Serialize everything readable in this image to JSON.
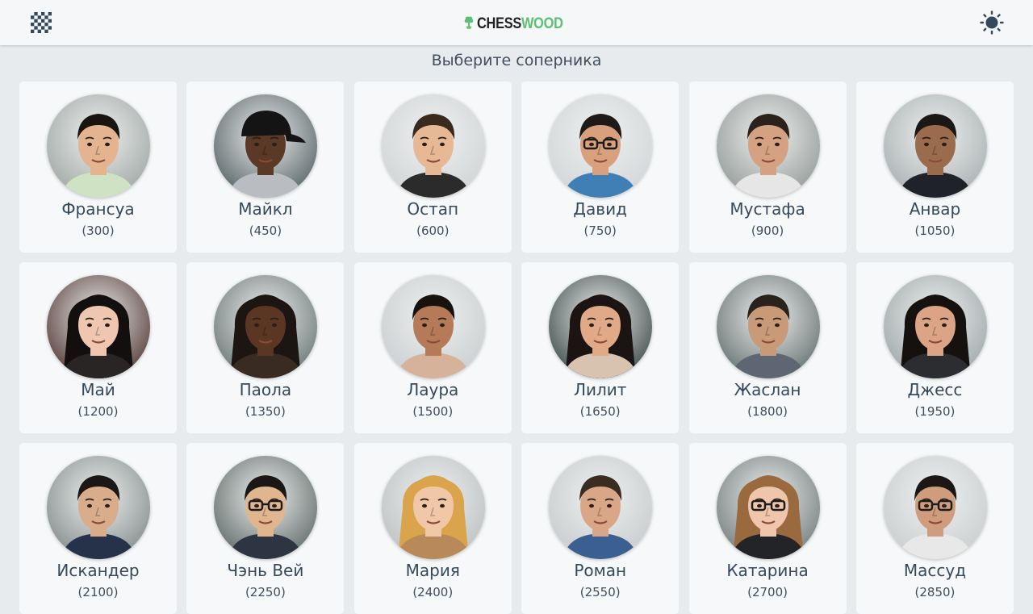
{
  "app": {
    "logo_text_dark": "CHESS",
    "logo_text_green": "WOOD",
    "subtitle": "Выберите соперника"
  },
  "icons": {
    "board": "chessboard-icon",
    "theme": "sun-icon",
    "logo": "tree-icon"
  },
  "colors": {
    "brand_green": "#5cbf74",
    "header_bg": "#f5f7f9",
    "page_bg": "#e8ebee",
    "card_bg": "#f6f8fa",
    "text": "#36495c"
  },
  "opponents": [
    {
      "name": "Франсуа",
      "rating": "(300)",
      "hair": "#1a1410",
      "skin": "#e3b48f",
      "shirt": "#cfe3c4",
      "bg": "#9aa29e",
      "hat": false,
      "glasses": false,
      "long_hair": false
    },
    {
      "name": "Майкл",
      "rating": "(450)",
      "hair": "#111111",
      "skin": "#5a3a26",
      "shirt": "#b9bdc2",
      "bg": "#4d5a5c",
      "hat": true,
      "glasses": false,
      "long_hair": false
    },
    {
      "name": "Остап",
      "rating": "(600)",
      "hair": "#3a2a1e",
      "skin": "#e6b896",
      "shirt": "#2b2b2b",
      "bg": "#cfd2d4",
      "hat": false,
      "glasses": false,
      "long_hair": false
    },
    {
      "name": "Давид",
      "rating": "(750)",
      "hair": "#1e1a17",
      "skin": "#d9a07e",
      "shirt": "#3f7fb5",
      "bg": "#cfd4d6",
      "hat": false,
      "glasses": true,
      "long_hair": false
    },
    {
      "name": "Мустафа",
      "rating": "(900)",
      "hair": "#2c221d",
      "skin": "#d4a283",
      "shirt": "#e6e6e6",
      "bg": "#8e9592",
      "hat": false,
      "glasses": false,
      "long_hair": false
    },
    {
      "name": "Анвар",
      "rating": "(1050)",
      "hair": "#1b1714",
      "skin": "#9b6b4d",
      "shirt": "#1f2329",
      "bg": "#a5acae",
      "hat": false,
      "glasses": false,
      "long_hair": false
    },
    {
      "name": "Май",
      "rating": "(1200)",
      "hair": "#120f0e",
      "skin": "#efc7b0",
      "shirt": "#2a2525",
      "bg": "#4a2e29",
      "hat": false,
      "glasses": false,
      "long_hair": true
    },
    {
      "name": "Паола",
      "rating": "(1350)",
      "hair": "#1c1512",
      "skin": "#5b3623",
      "shirt": "#3a2b22",
      "bg": "#62706d",
      "hat": false,
      "glasses": false,
      "long_hair": true
    },
    {
      "name": "Лаура",
      "rating": "(1500)",
      "hair": "#18120f",
      "skin": "#b57a57",
      "shirt": "#d6b29a",
      "bg": "#c8ccce",
      "hat": false,
      "glasses": false,
      "long_hair": false
    },
    {
      "name": "Лилит",
      "rating": "(1650)",
      "hair": "#1b1412",
      "skin": "#e0a987",
      "shirt": "#d8c2b0",
      "bg": "#33423f",
      "hat": false,
      "glasses": false,
      "long_hair": true
    },
    {
      "name": "Жаслан",
      "rating": "(1800)",
      "hair": "#2a221d",
      "skin": "#c89a78",
      "shirt": "#5d6672",
      "bg": "#5e6969",
      "hat": false,
      "glasses": false,
      "long_hair": false
    },
    {
      "name": "Джесс",
      "rating": "(1950)",
      "hair": "#15110f",
      "skin": "#dba486",
      "shirt": "#2b2d30",
      "bg": "#9aa3a4",
      "hat": false,
      "glasses": false,
      "long_hair": true
    },
    {
      "name": "Искандер",
      "rating": "(2100)",
      "hair": "#1b1714",
      "skin": "#d9ac8c",
      "shirt": "#26324a",
      "bg": "#7d8785",
      "hat": false,
      "glasses": false,
      "long_hair": false
    },
    {
      "name": "Чэнь Вей",
      "rating": "(2250)",
      "hair": "#1c1714",
      "skin": "#e0b691",
      "shirt": "#2d3442",
      "bg": "#56625f",
      "hat": false,
      "glasses": true,
      "long_hair": false
    },
    {
      "name": "Мария",
      "rating": "(2400)",
      "hair": "#d9a44b",
      "skin": "#f0c8a8",
      "shirt": "#b88a5a",
      "bg": "#b9bebf",
      "hat": false,
      "glasses": false,
      "long_hair": true
    },
    {
      "name": "Роман",
      "rating": "(2550)",
      "hair": "#3b2c22",
      "skin": "#d9a788",
      "shirt": "#3b5f90",
      "bg": "#c5c9cb",
      "hat": false,
      "glasses": false,
      "long_hair": false
    },
    {
      "name": "Катарина",
      "rating": "(2700)",
      "hair": "#9a6a3e",
      "skin": "#efc6ac",
      "shirt": "#222428",
      "bg": "#6b7575",
      "hat": false,
      "glasses": true,
      "long_hair": true
    },
    {
      "name": "Массуд",
      "rating": "(2850)",
      "hair": "#1b1714",
      "skin": "#cf9d7e",
      "shirt": "#e8e8e8",
      "bg": "#c7cbcc",
      "hat": false,
      "glasses": true,
      "long_hair": false
    }
  ]
}
